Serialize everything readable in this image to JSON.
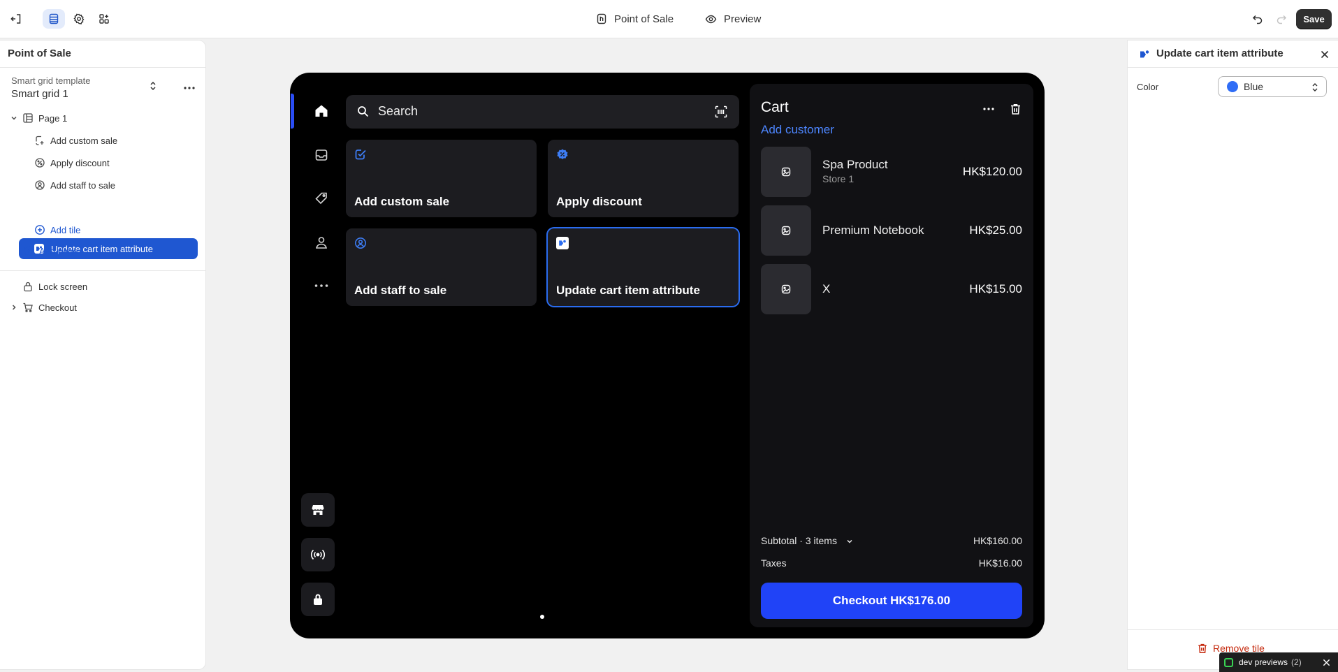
{
  "topbar": {
    "app_title": "Point of Sale",
    "preview_label": "Preview",
    "save_label": "Save"
  },
  "left_panel": {
    "title": "Point of Sale",
    "template_label": "Smart grid template",
    "template_name": "Smart grid 1",
    "page_label": "Page 1",
    "tiles": [
      {
        "label": "Add custom sale",
        "icon": "custom-sale-icon"
      },
      {
        "label": "Apply discount",
        "icon": "discount-icon"
      },
      {
        "label": "Add staff to sale",
        "icon": "staff-icon"
      },
      {
        "label": "Update cart item attribute",
        "icon": "cart-attribute-icon",
        "selected": true
      }
    ],
    "add_tile_label": "Add tile",
    "add_page_label": "Add page",
    "lock_screen_label": "Lock screen",
    "checkout_label": "Checkout"
  },
  "device": {
    "search_label": "Search",
    "tiles": [
      {
        "label": "Add custom sale"
      },
      {
        "label": "Apply discount"
      },
      {
        "label": "Add staff to sale"
      },
      {
        "label": "Update cart item attribute"
      }
    ],
    "cart": {
      "title": "Cart",
      "add_customer": "Add customer",
      "items": [
        {
          "name": "Spa Product",
          "sub": "Store 1",
          "price": "HK$120.00"
        },
        {
          "name": "Premium Notebook",
          "sub": "",
          "price": "HK$25.00"
        },
        {
          "name": "X",
          "sub": "",
          "price": "HK$15.00"
        }
      ],
      "subtotal_label": "Subtotal · 3 items",
      "subtotal_value": "HK$160.00",
      "taxes_label": "Taxes",
      "taxes_value": "HK$16.00",
      "checkout_label": "Checkout HK$176.00"
    }
  },
  "right_panel": {
    "title": "Update cart item attribute",
    "color_label": "Color",
    "color_value": "Blue",
    "color_swatch": "#2f6df6",
    "remove_label": "Remove tile"
  },
  "dev_bar": {
    "label": "dev previews",
    "count": "(2)"
  },
  "colors": {
    "accent": "#1f57d1",
    "checkout_button": "#2043f7",
    "device_bg": "#000000"
  }
}
